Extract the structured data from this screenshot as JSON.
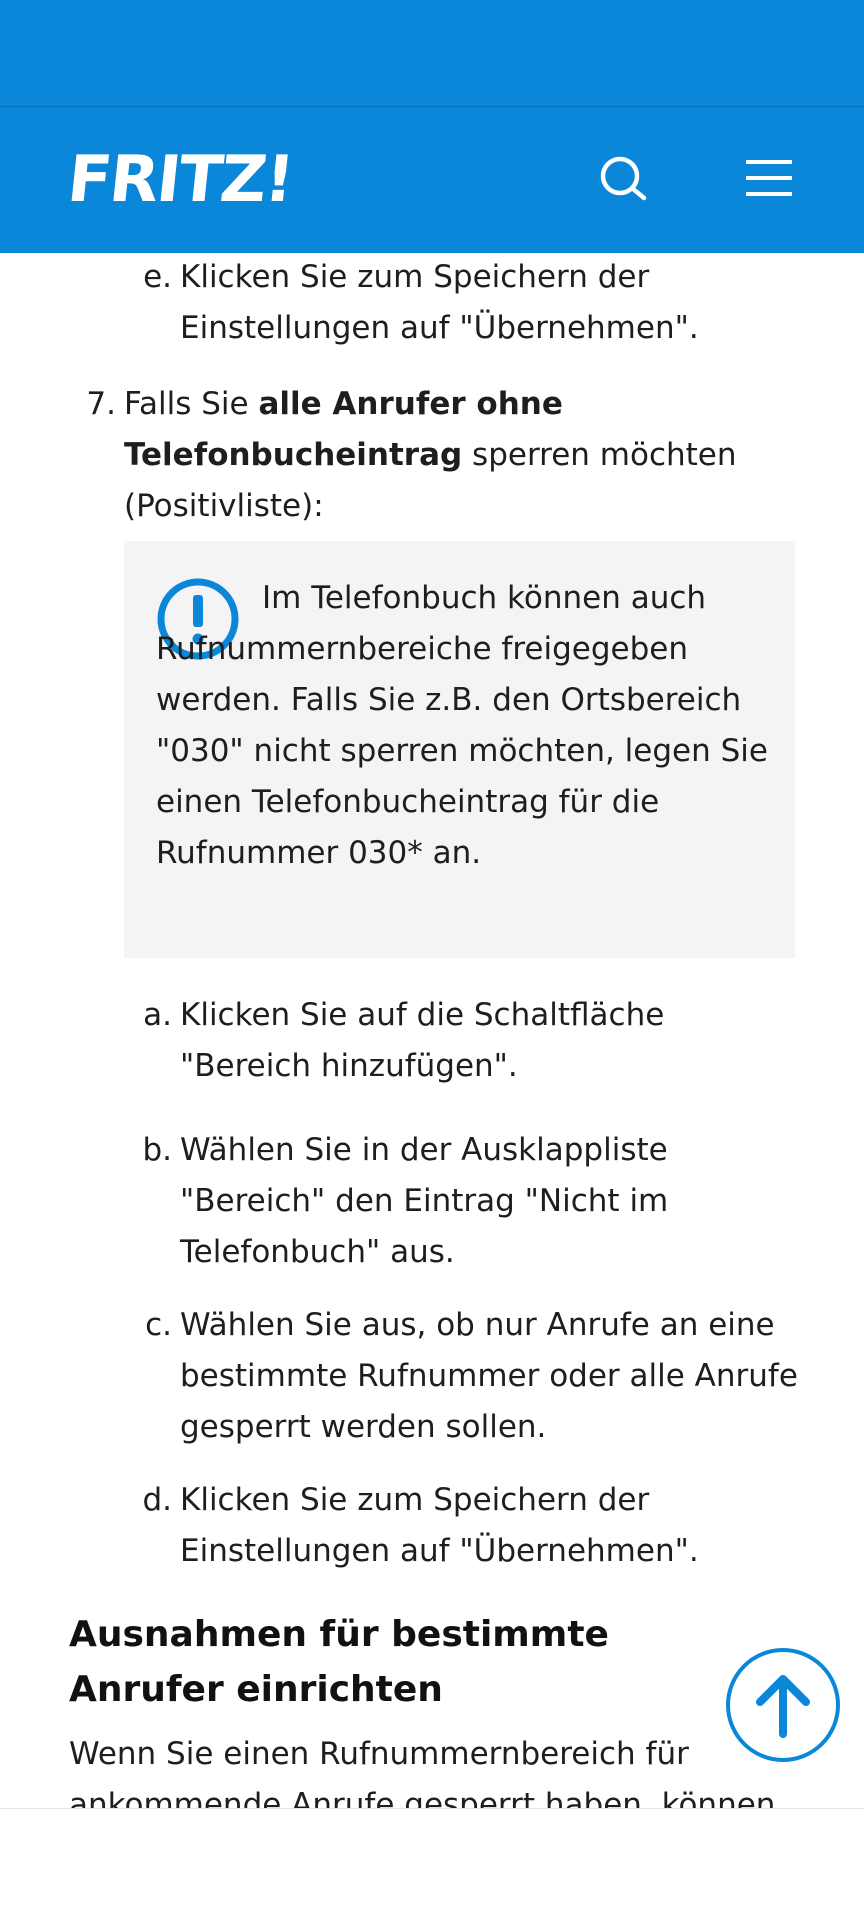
{
  "header": {
    "logo_text": "FRITZ!",
    "accent_color": "#0a87d8",
    "search_icon": "search-icon",
    "menu_icon": "hamburger-menu-icon"
  },
  "steps": {
    "prev_e": {
      "marker": "e.",
      "text": "Klicken Sie zum Speichern der Einstellungen auf \"Übernehmen\"."
    },
    "step7": {
      "marker": "7.",
      "text_prefix": "Falls Sie ",
      "text_bold": "alle Anrufer ohne Telefonbucheintrag",
      "text_suffix": " sperren möchten (Positivliste):"
    },
    "note": {
      "icon": "exclamation-circle-icon",
      "text": "Im Telefonbuch können auch Rufnummernbereiche freigegeben werden. Falls Sie z.B. den Ortsbereich \"030\" nicht sperren möchten, legen Sie einen Telefonbucheintrag für die Rufnummer 030* an."
    },
    "substeps": [
      {
        "marker": "a.",
        "text": "Klicken Sie auf die Schaltfläche \"Bereich hinzufügen\"."
      },
      {
        "marker": "b.",
        "text": "Wählen Sie in der Ausklappliste \"Bereich\" den Eintrag \"Nicht im Telefonbuch\" aus."
      },
      {
        "marker": "c.",
        "text": "Wählen Sie aus, ob nur Anrufe an eine bestimmte Rufnummer oder alle Anrufe gesperrt werden sollen."
      },
      {
        "marker": "d.",
        "text": "Klicken Sie zum Speichern der Einstellungen auf \"Übernehmen\"."
      }
    ]
  },
  "section": {
    "heading": "Ausnahmen für bestimmte Anrufer einrichten",
    "paragraph": "Wenn Sie einen Rufnummernbereich für ankommende Anrufe gesperrt haben, können"
  },
  "scroll_top_icon": "arrow-up-icon"
}
